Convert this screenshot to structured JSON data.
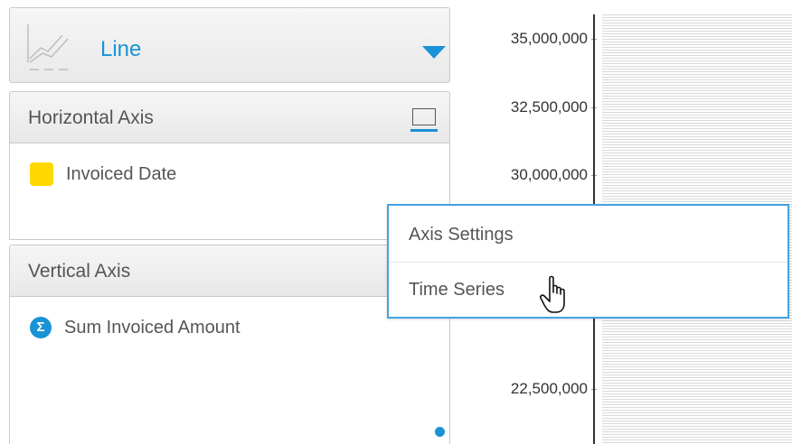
{
  "chart_type_selector": {
    "label": "Line",
    "icon": "line-chart-icon"
  },
  "horizontal_axis": {
    "title": "Horizontal Axis",
    "field": {
      "label": "Invoiced Date",
      "icon": "date-field-icon",
      "color": "#ffd800"
    }
  },
  "vertical_axis": {
    "title": "Vertical Axis",
    "field": {
      "label": "Sum Invoiced Amount",
      "icon": "sigma-icon",
      "icon_text": "Σ",
      "color": "#1a92d6"
    }
  },
  "chart_preview": {
    "y_ticks": [
      "35,000,000",
      "32,500,000",
      "30,000,000",
      "22,500,000"
    ]
  },
  "context_menu": {
    "items": [
      {
        "label": "Axis Settings"
      },
      {
        "label": "Time Series"
      }
    ]
  },
  "colors": {
    "accent": "#1a92d6",
    "menu_border": "#45a3e0"
  }
}
